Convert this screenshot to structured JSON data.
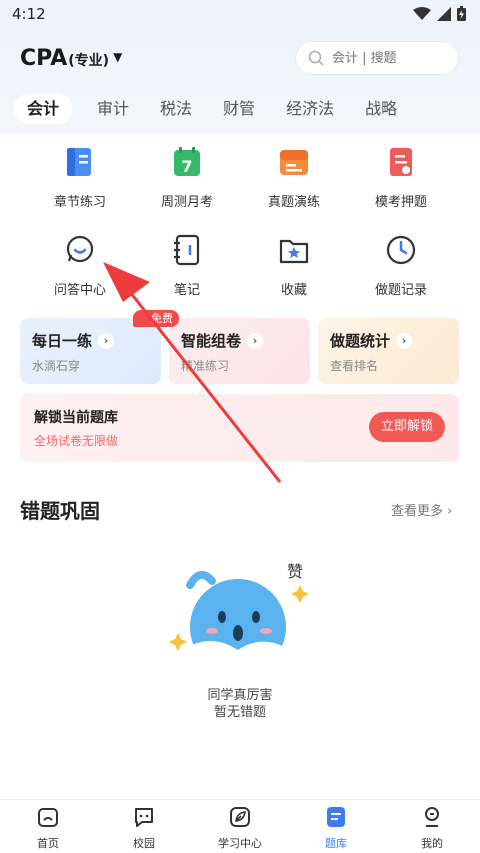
{
  "status_bar": {
    "time": "4:12"
  },
  "header": {
    "exam_name": "CPA",
    "exam_sub": "(专业)",
    "search_placeholder": "会计 | 搜题"
  },
  "tabs": [
    {
      "label": "会计",
      "active": true
    },
    {
      "label": "审计"
    },
    {
      "label": "税法"
    },
    {
      "label": "财管"
    },
    {
      "label": "经济法"
    },
    {
      "label": "战略"
    }
  ],
  "grid": [
    {
      "label": "章节练习",
      "icon": "chapter-book-icon"
    },
    {
      "label": "周测月考",
      "icon": "calendar-7-icon"
    },
    {
      "label": "真题演练",
      "icon": "exam-paper-icon"
    },
    {
      "label": "模考押题",
      "icon": "mock-exam-icon"
    },
    {
      "label": "问答中心",
      "icon": "qa-chat-icon"
    },
    {
      "label": "笔记",
      "icon": "notebook-icon"
    },
    {
      "label": "收藏",
      "icon": "star-folder-icon"
    },
    {
      "label": "做题记录",
      "icon": "clock-icon"
    }
  ],
  "cards": [
    {
      "title": "每日一练",
      "subtitle": "水滴石穿"
    },
    {
      "title": "智能组卷",
      "subtitle": "精准练习"
    },
    {
      "title": "做题统计",
      "subtitle": "查看排名"
    }
  ],
  "free_badge": "免费",
  "unlock": {
    "title": "解锁当前题库",
    "subtitle": "全场试卷无限做",
    "button": "立即解锁"
  },
  "wrong_section": {
    "title": "错题巩固",
    "more": "查看更多",
    "praise": "赞",
    "empty_line1": "同学真厉害",
    "empty_line2": "暂无错题"
  },
  "bottom_nav": [
    {
      "label": "首页",
      "icon": "home-icon"
    },
    {
      "label": "校园",
      "icon": "chat-bubble-icon"
    },
    {
      "label": "学习中心",
      "icon": "leaf-icon"
    },
    {
      "label": "题库",
      "icon": "question-bank-icon",
      "active": true
    },
    {
      "label": "我的",
      "icon": "profile-icon"
    }
  ],
  "colors": {
    "accent": "#3d7cf2",
    "unlock_button": "#ee5a55",
    "arrow": "#ee3b3b"
  }
}
